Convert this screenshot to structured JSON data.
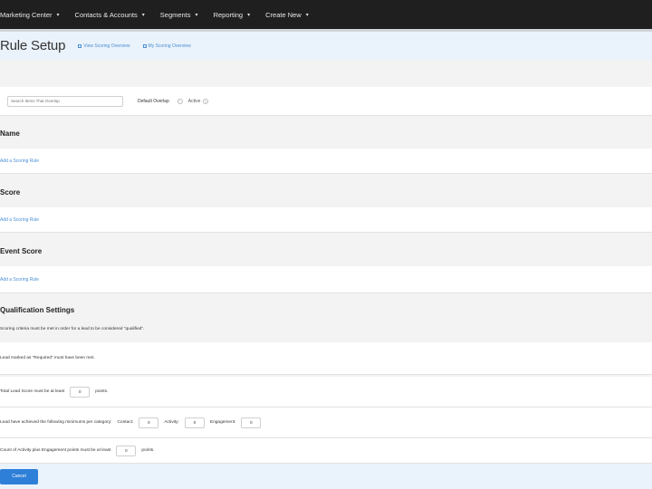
{
  "nav": {
    "items": [
      {
        "label": "Marketing Center"
      },
      {
        "label": "Contacts & Accounts"
      },
      {
        "label": "Segments"
      },
      {
        "label": "Reporting"
      },
      {
        "label": "Create New"
      }
    ]
  },
  "header": {
    "title": "Rule Setup",
    "links": [
      "View Scoring Overview",
      "My Scoring Overview"
    ]
  },
  "filter": {
    "search_placeholder": "Search Items That Overlap",
    "label": "Default Overlap",
    "status": "Active"
  },
  "sections": [
    {
      "title": "Name",
      "link": "Add a Scoring Rule"
    },
    {
      "title": "Score",
      "link": "Add a Scoring Rule"
    },
    {
      "title": "Event Score",
      "link": "Add a Scoring Rule"
    }
  ],
  "qualification": {
    "title": "Qualification Settings",
    "description": "Scoring criteria must be met in order for a lead to be considered \"qualified\".",
    "criteria": {
      "row1": "Lead marked as \"Required\" must have been met.",
      "row2_prefix": "Total Lead Score must be at least",
      "row2_value": "0",
      "row2_suffix": "points.",
      "row3_prefix": "Lead have achieved the following minimums per category:",
      "row3_contact_label": "Contact:",
      "row3_contact_value": "0",
      "row3_activity_label": "Activity:",
      "row3_activity_value": "0",
      "row3_engagement_label": "Engagement:",
      "row3_engagement_value": "0",
      "row4_prefix": "Count of Activity plus Engagement points must be at least",
      "row4_value": "0",
      "row4_suffix": "points."
    }
  },
  "footer": {
    "cancel_label": "Cancel"
  }
}
